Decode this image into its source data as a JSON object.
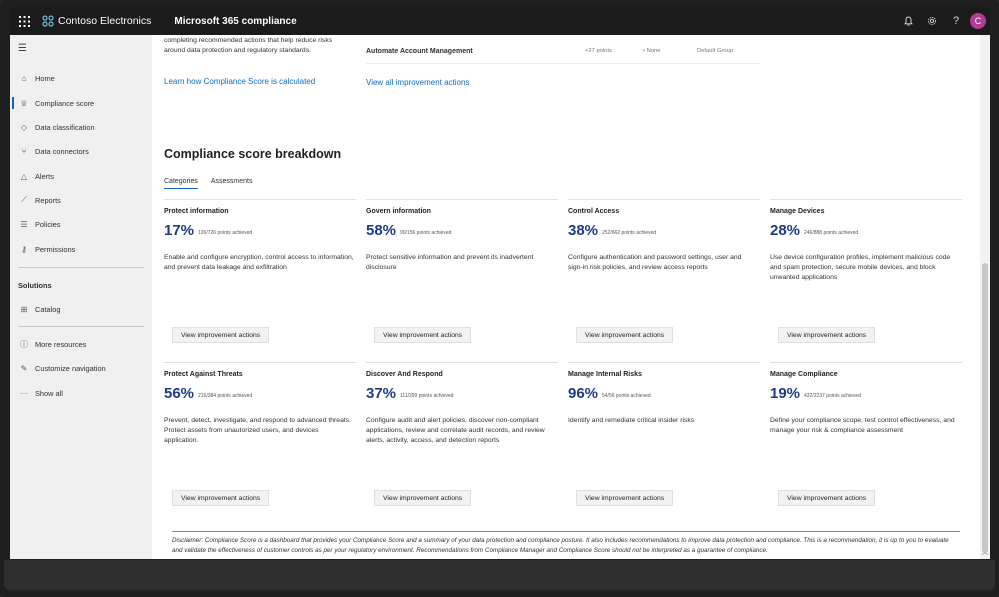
{
  "topbar": {
    "org_name": "Contoso Electronics",
    "product_name": "Microsoft 365 compliance",
    "avatar_initial": "C",
    "icons": [
      "waffle-icon",
      "bell-icon",
      "gear-icon",
      "help-icon"
    ]
  },
  "sidebar": {
    "items": [
      {
        "label": "Home",
        "icon": "home-icon"
      },
      {
        "label": "Compliance score",
        "icon": "trophy-icon"
      },
      {
        "label": "Data classification",
        "icon": "tag-icon"
      },
      {
        "label": "Data connectors",
        "icon": "connector-icon"
      },
      {
        "label": "Alerts",
        "icon": "warning-icon"
      },
      {
        "label": "Reports",
        "icon": "chart-icon"
      },
      {
        "label": "Policies",
        "icon": "sliders-icon"
      },
      {
        "label": "Permissions",
        "icon": "key-icon"
      }
    ],
    "solutions_heading": "Solutions",
    "solutions_items": [
      {
        "label": "Catalog",
        "icon": "grid-icon"
      }
    ],
    "footer_items": [
      {
        "label": "More resources",
        "icon": "info-icon"
      },
      {
        "label": "Customize navigation",
        "icon": "pencil-icon"
      },
      {
        "label": "Show all",
        "icon": "ellipsis-icon"
      }
    ]
  },
  "top_section": {
    "intro_line1": "completing recommended actions that help reduce risks",
    "intro_line2": "around data protection and regulatory standards.",
    "learn_link": "Learn how Compliance Score is calculated",
    "action_name": "Automate Account Management",
    "action_points": "+27 points",
    "action_status": "• None",
    "action_group": "Default Group",
    "view_all_link": "View all improvement actions"
  },
  "breakdown": {
    "title": "Compliance score breakdown",
    "tabs": [
      "Categories",
      "Assessments"
    ],
    "button_label": "View improvement actions",
    "cards": [
      {
        "title": "Protect information",
        "pct": "17%",
        "pts": "126/726 points achieved",
        "desc": "Enable and configure encryption, control access to information, and prevent data leakage and exfiltration"
      },
      {
        "title": "Govern information",
        "pct": "58%",
        "pts": "90/156 points achieved",
        "desc": "Protect sensitive information and prevent its inadvertent disclosure"
      },
      {
        "title": "Control Access",
        "pct": "38%",
        "pts": "252/662 points achieved",
        "desc": "Configure authentication and password settings, user and sign-in risk policies, and review access reports"
      },
      {
        "title": "Manage Devices",
        "pct": "28%",
        "pts": "246/888 points achieved",
        "desc": "Use device configuration profiles, implement malicious code and spam protection, secure mobile devices, and block unwanted applications"
      },
      {
        "title": "Protect Against Threats",
        "pct": "56%",
        "pts": "216/384 points achieved",
        "desc": "Prevent, detect, investigate, and respond to advanced threats. Protect assets from unautorized users, and devices application."
      },
      {
        "title": "Discover And Respond",
        "pct": "37%",
        "pts": "111/299 points achieved",
        "desc": "Configure audit and alert policies, discover non-compliant applications, review and correlate audit records, and review alerts, activity, access, and detection reports"
      },
      {
        "title": "Manage Internal Risks",
        "pct": "96%",
        "pts": "54/56 points achieved",
        "desc": "Identify and remediate critical insider risks"
      },
      {
        "title": "Manage Compliance",
        "pct": "19%",
        "pts": "432/2237 points achieved",
        "desc": "Define your compliance scope, test control effectiveness, and manage your risk & compliance assessment"
      }
    ]
  },
  "disclaimer": "Disclaimer: Compliance Score is a dashboard that provides your Compliance Score and a summary of your data protection and compliance posture. It also includes recommendations to improve data protection and compliance. This is a recommendation, it is up to you to evaluate and validate the effectiveness of customer controls as per your regulatory environment. Recommendations from Compliance Manager and Compliance Score should not be interpreted as a guarantee of compliance.",
  "colors": {
    "topbar": "#1b1b1b",
    "accent": "#0f6cbd",
    "score": "#1e3a8a",
    "avatar": "#b23c98"
  }
}
